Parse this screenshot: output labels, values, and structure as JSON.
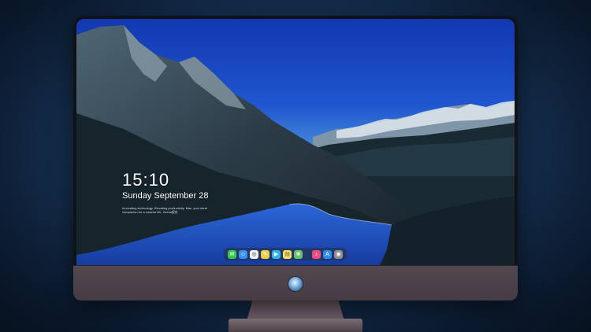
{
  "lock_screen": {
    "time": "15:10",
    "date": "Sunday September 28",
    "tagline": "Innovating technology. Elevating productivity. Mac, your ideal companion for a smarter life. Zeeka設計"
  },
  "dock": {
    "items": [
      {
        "name": "messages-icon",
        "color": "#37c84f",
        "glyph": "✉"
      },
      {
        "name": "finder-icon",
        "color": "#3b8ff0",
        "glyph": "☺"
      },
      {
        "name": "safari-icon",
        "color": "#f1f4f8",
        "glyph": "◎"
      },
      {
        "name": "notes-icon",
        "color": "#f5cc4a",
        "glyph": "✎"
      },
      {
        "name": "clapper-icon",
        "color": "#2fb6e8",
        "glyph": "▶"
      },
      {
        "name": "stickies-icon",
        "color": "#f7e06a",
        "glyph": "▤"
      },
      {
        "name": "photos-icon",
        "color": "#6bbf6d",
        "glyph": "❀"
      },
      {
        "name": "music-icon",
        "color": "#f04b7e",
        "glyph": "♪"
      },
      {
        "name": "app-store-icon",
        "color": "#2b8ef0",
        "glyph": "A"
      },
      {
        "name": "camera-icon",
        "color": "#8e8f96",
        "glyph": "◉"
      }
    ]
  }
}
